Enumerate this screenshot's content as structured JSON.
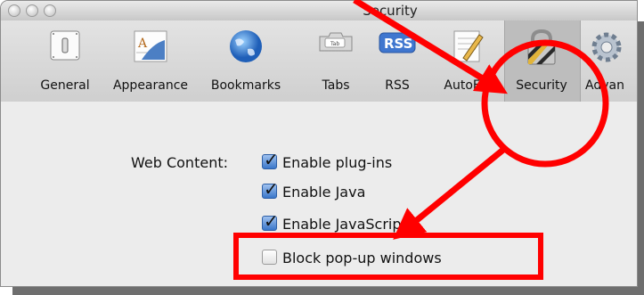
{
  "window": {
    "title": "Security"
  },
  "toolbar": {
    "items": [
      {
        "label": "General",
        "icon": "switch-icon"
      },
      {
        "label": "Appearance",
        "icon": "font-pen-icon"
      },
      {
        "label": "Bookmarks",
        "icon": "globe-icon"
      },
      {
        "label": "Tabs",
        "icon": "tab-icon"
      },
      {
        "label": "RSS",
        "icon": "rss-icon"
      },
      {
        "label": "AutoFill",
        "icon": "pencil-form-icon"
      },
      {
        "label": "Security",
        "icon": "padlock-icon"
      },
      {
        "label": "Advan",
        "icon": "gear-icon"
      }
    ],
    "tab_badge": "Tab",
    "rss_badge": "RSS",
    "selected": "Security"
  },
  "security": {
    "web_content_label": "Web Content:",
    "options": [
      {
        "label": "Enable plug-ins",
        "checked": true
      },
      {
        "label": "Enable Java",
        "checked": true
      },
      {
        "label": "Enable JavaScript",
        "checked": true
      },
      {
        "label": "Block pop-up windows",
        "checked": false
      }
    ]
  },
  "annotations": {
    "color": "#ff0000"
  }
}
